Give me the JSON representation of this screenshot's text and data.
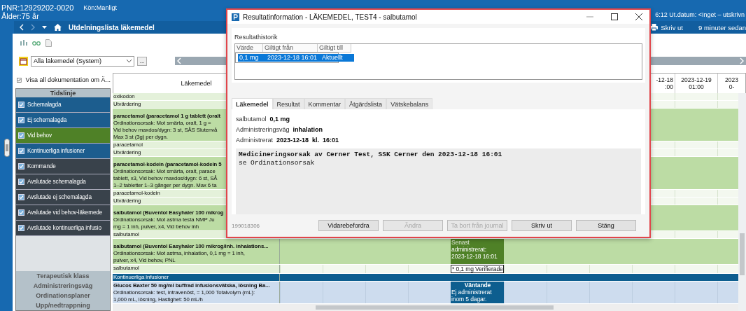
{
  "patient": {
    "pnr": "PNR:12929202-0020",
    "gender": "Kön:Manligt",
    "age": "Ålder:75 år",
    "discharge": "6:12 Ut.datum: <Inget – utskrivn"
  },
  "nav": {
    "title": "Utdelningslista läkemedel",
    "print": "Skriv ut",
    "refresh": "9 minuter sedan"
  },
  "filter": {
    "value": "Alla läkemedel (System)",
    "more": "..."
  },
  "show_all": {
    "label": "Visa all dokumentation om Ä...",
    "checked": true
  },
  "timeline": {
    "title": "Tidslinje",
    "items": [
      {
        "label": "Schemalagda",
        "checked": true,
        "color": "#1c5d8e"
      },
      {
        "label": "Ej schemalagda",
        "checked": true,
        "color": "#1c5d8e"
      },
      {
        "label": "Vid behov",
        "checked": true,
        "color": "#4f8127"
      },
      {
        "label": "Kontinuerliga infusioner",
        "checked": true,
        "color": "#1c5d8e"
      },
      {
        "label": "Kommande",
        "checked": true,
        "color": "#39424b"
      },
      {
        "label": "Avslutade schemalagda",
        "checked": true,
        "color": "#39424b"
      },
      {
        "label": "Avslutade ej schemalagda",
        "checked": true,
        "color": "#39424b"
      },
      {
        "label": "Avslutade vid behov-läkemede",
        "checked": true,
        "color": "#39424b"
      },
      {
        "label": "Avslutade kontinuerliga infusio",
        "checked": true,
        "color": "#39424b"
      }
    ]
  },
  "categories": [
    "Terapeutisk klass",
    "Administreringsväg",
    "Ordinationsplaner",
    "Upp/nedtrappning"
  ],
  "grid": {
    "column": "Läkemedel",
    "time_columns": [
      {
        "date": "-12-18",
        "time": ":00"
      },
      {
        "date": "2023-12-19",
        "time": "01:00"
      },
      {
        "date": "2023",
        "time": "0-"
      }
    ],
    "rows": [
      {
        "kind": "name",
        "lines": [
          "oxikodon"
        ]
      },
      {
        "kind": "name",
        "lines": [
          "Utvärdering"
        ]
      },
      {
        "kind": "order",
        "lines": [
          "paracetamol (paracetamol 1 g tablett (oralt",
          "Ordinationsorsak: Mot smärta, oralt, 1 g =",
          "Vid behov maxdos/dygn: 3 st, SÅS Slutenvå",
          "Max 3 st (3g) per dygn."
        ]
      },
      {
        "kind": "name",
        "lines": [
          "paracetamol"
        ]
      },
      {
        "kind": "name",
        "lines": [
          "Utvärdering"
        ]
      },
      {
        "kind": "order",
        "lines": [
          "paracetamol-kodein (paracetamol-kodein 5",
          "Ordinationsorsak: Mot smärta, oralt, parace",
          "tablett, x3, Vid behov maxdos/dygn: 6 st, SÅ",
          "1–2 tabletter 1–3 gånger per dygn. Max 6 ta"
        ]
      },
      {
        "kind": "name",
        "lines": [
          "paracetamol-kodein"
        ]
      },
      {
        "kind": "name",
        "lines": [
          "Utvärdering"
        ]
      },
      {
        "kind": "order",
        "lines": [
          "salbutamol (Buventol Easyhaler 100 mikrog",
          "Ordinationsorsak: Mot astma testa NMP Ju",
          "mg = 1 inh, pulver, x4, Vid behov inh"
        ]
      },
      {
        "kind": "name",
        "lines": [
          "salbutamol"
        ]
      },
      {
        "kind": "order",
        "lines": [
          "salbutamol (Buventol Easyhaler 100 mikrog/inh. inhalations...",
          "Ordinationsorsak: Mot astma, inhalation, 0,1 mg = 1 inh,",
          "pulver, x4, Vid behov, PNL"
        ],
        "cell": {
          "kind": "administered",
          "lines": [
            "Senast",
            "administrerat:",
            "2023-12-18 16:01"
          ]
        }
      },
      {
        "kind": "name",
        "lines": [
          "salbutamol"
        ],
        "cell": {
          "kind": "verified",
          "lines": [
            "* 0,1 mg Verifierade"
          ]
        }
      },
      {
        "kind": "section",
        "lines": [
          "Kontinuerliga infusioner"
        ]
      },
      {
        "kind": "infusion",
        "lines": [
          "Glucos Baxter 50 mg/ml buffrad infusionsvätska, lösning Ba...",
          "Ordinationsorsak: test, intravenöst, = 1,000 Totalvolym (mL):",
          "1,000 mL, lösning, Hastighet: 50 mL/h"
        ],
        "cell": {
          "kind": "pending",
          "lines": [
            "Väntande",
            "Ej administrerat",
            "inom 5 dagar."
          ]
        }
      }
    ]
  },
  "dialog": {
    "title": "Resultatinformation - LÄKEMEDEL, TEST4 - salbutamol",
    "history_title": "Resultathistorik",
    "columns": [
      "Värde",
      "Giltigt från",
      "Giltigt till"
    ],
    "rows": [
      {
        "cells": [
          "0,1 mg",
          "2023-12-18 16:01",
          "Aktuellt"
        ],
        "selected": true
      }
    ],
    "tabs": [
      {
        "label": "Läkemedel",
        "selected": true
      },
      {
        "label": "Resultat",
        "selected": false
      },
      {
        "label": "Kommentar",
        "selected": false
      },
      {
        "label": "Åtgärdslista",
        "selected": false
      },
      {
        "label": "Vätskebalans",
        "selected": false
      }
    ],
    "fields": [
      {
        "label": "salbutamol",
        "value": "0,1 mg"
      },
      {
        "label": "Administreringsväg",
        "value": "inhalation"
      },
      {
        "label": "Administrerat",
        "value": "2023-12-18  kl.  16:01"
      }
    ],
    "note": [
      {
        "text": "Medicineringsorsak av Cerner Test, SSK Cerner den 2023-12-18 16:01",
        "bold": true
      },
      {
        "text": "se Ordinationsorsak",
        "bold": false
      }
    ],
    "id": "199018306",
    "buttons": [
      {
        "label": "Vidarebefordra",
        "disabled": false
      },
      {
        "label": "Ändra",
        "disabled": true
      },
      {
        "label": "Ta bort från journal",
        "disabled": true
      },
      {
        "label": "Skriv ut",
        "disabled": false
      },
      {
        "label": "Stäng",
        "disabled": false
      }
    ]
  }
}
